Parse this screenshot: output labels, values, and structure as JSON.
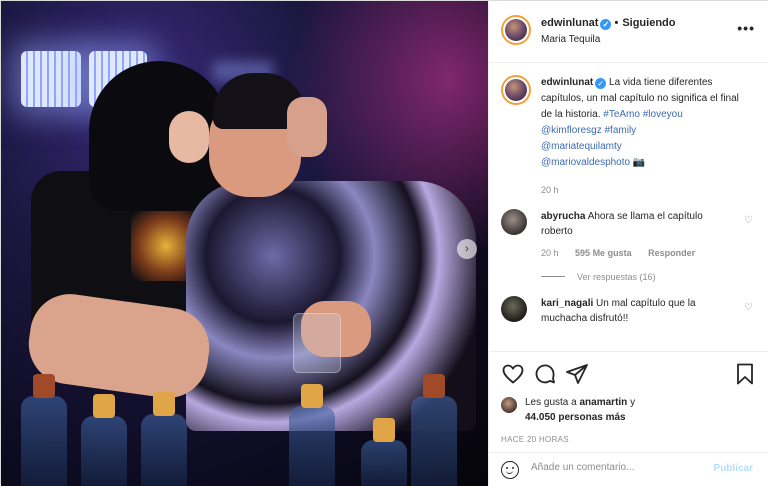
{
  "post": {
    "username": "edwinlunat",
    "separator": "•",
    "follow_status": "Siguiendo",
    "location": "Maria Tequila",
    "more_label": "•••"
  },
  "caption": {
    "username": "edwinlunat",
    "text": "La vida tiene diferentes capítulos, un mal capítulo no significa el final de la historia.",
    "tags": [
      "#TeAmo",
      "#loveyou"
    ],
    "mention1": "@kimfloresgz",
    "tag3": "#family",
    "mention2": "@mariatequilamty",
    "mention3": "@mariovaldesphoto",
    "camera_emoji": "📷",
    "time": "20 h"
  },
  "comments": [
    {
      "username": "abyrucha",
      "text": "Ahora se llama el capítulo roberto",
      "time": "20 h",
      "likes": "595 Me gusta",
      "reply": "Responder",
      "view_replies": "Ver respuestas (16)"
    },
    {
      "username": "kari_nagali",
      "text": "Un mal capítulo que la muchacha disfrutó!!"
    }
  ],
  "likes": {
    "liked_by_prefix": "Les gusta a",
    "liked_by_user": "anamartin",
    "conjunction": "y",
    "count_text": "44.050 personas más",
    "ago": "HACE 20 HORAS"
  },
  "add_comment": {
    "placeholder": "Añade un comentario...",
    "post_label": "Publicar"
  },
  "photo": {
    "next_arrow": "›"
  },
  "colors": {
    "link": "#00376b",
    "verified": "#3897f0",
    "post_disabled": "#b2dffc",
    "muted": "#8e8e8e"
  }
}
